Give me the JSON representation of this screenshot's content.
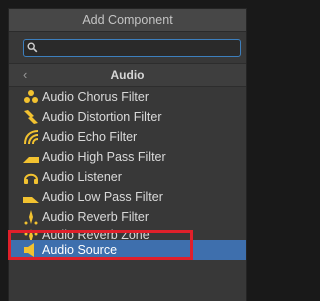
{
  "panel": {
    "title": "Add Component",
    "search": {
      "value": "",
      "placeholder": ""
    },
    "category": {
      "title": "Audio",
      "back_icon": "chevron-left-icon"
    },
    "items": [
      {
        "label": "Audio Chorus Filter",
        "icon": "audio-chorus-filter-icon"
      },
      {
        "label": "Audio Distortion Filter",
        "icon": "audio-distortion-filter-icon"
      },
      {
        "label": "Audio Echo Filter",
        "icon": "audio-echo-filter-icon"
      },
      {
        "label": "Audio High Pass Filter",
        "icon": "audio-high-pass-filter-icon"
      },
      {
        "label": "Audio Listener",
        "icon": "audio-listener-icon"
      },
      {
        "label": "Audio Low Pass Filter",
        "icon": "audio-low-pass-filter-icon"
      },
      {
        "label": "Audio Reverb Filter",
        "icon": "audio-reverb-filter-icon"
      },
      {
        "label": "Audio Reverb Zone",
        "icon": "audio-reverb-zone-icon"
      },
      {
        "label": "Audio Source",
        "icon": "audio-source-icon",
        "selected": true
      }
    ]
  },
  "colors": {
    "icon_yellow": "#f2c230",
    "selection": "#3e6fad",
    "highlight_border": "#e0202a",
    "search_border": "#3d7fbd"
  }
}
